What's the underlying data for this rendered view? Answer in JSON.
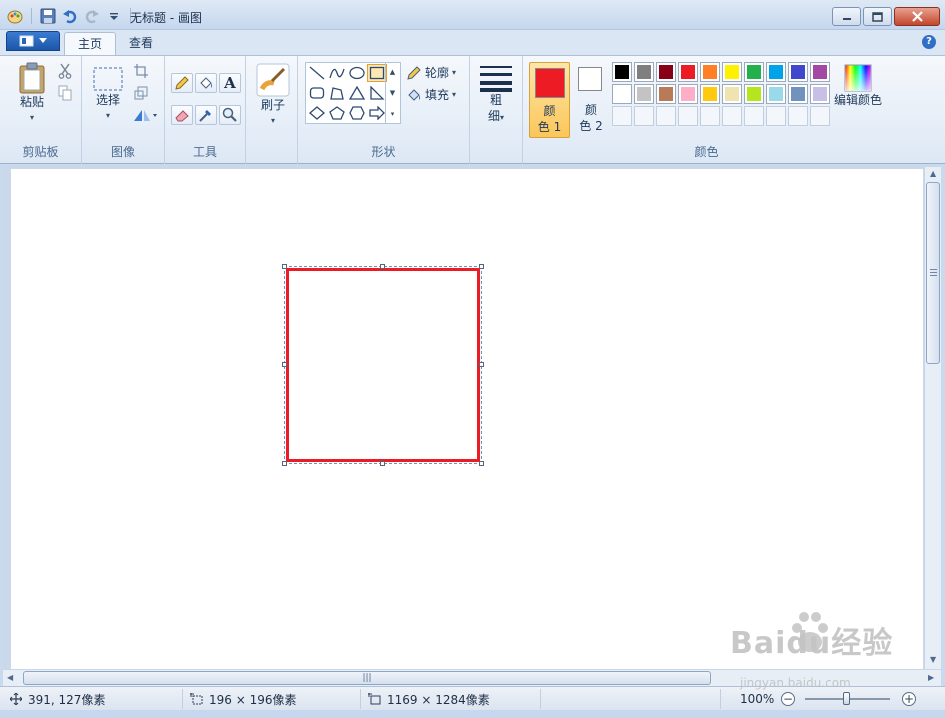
{
  "window": {
    "title": "无标题 - 画图"
  },
  "tabs": [
    {
      "label": "主页"
    },
    {
      "label": "查看"
    }
  ],
  "help_label": "?",
  "ribbon": {
    "clipboard": {
      "paste_label": "粘贴",
      "group_label": "剪贴板"
    },
    "image": {
      "select_label": "选择",
      "group_label": "图像"
    },
    "tools": {
      "group_label": "工具",
      "text_glyph": "A"
    },
    "brushes": {
      "label": "刷子"
    },
    "shapes": {
      "outline_label": "轮廓",
      "fill_label": "填充",
      "group_label": "形状"
    },
    "size": {
      "label_line1": "粗",
      "label_line2": "细"
    },
    "colors": {
      "color1_line1": "颜",
      "color1_line2": "色 1",
      "color2_line1": "颜",
      "color2_line2": "色 2",
      "edit_label": "编辑颜色",
      "group_label": "颜色",
      "color1_value": "#ed1c24",
      "color2_value": "#ffffff",
      "palette_row1": [
        "#000000",
        "#7f7f7f",
        "#880015",
        "#ed1c24",
        "#ff7f27",
        "#fff200",
        "#22b14c",
        "#00a2e8",
        "#3f48cc",
        "#a349a4"
      ],
      "palette_row2": [
        "#ffffff",
        "#c3c3c3",
        "#b97a57",
        "#ffaec9",
        "#ffc90e",
        "#efe4b0",
        "#b5e61d",
        "#99d9ea",
        "#7092be",
        "#c8bfe7"
      ]
    }
  },
  "canvas": {
    "shape_outline_color": "#ed1c24"
  },
  "status": {
    "cursor_pos": "391, 127像素",
    "selection_size": "196 × 196像素",
    "image_size": "1169 × 1284像素",
    "zoom": "100%"
  },
  "watermark": {
    "brand": "Baidu经验",
    "url": "jingyan.baidu.com"
  }
}
